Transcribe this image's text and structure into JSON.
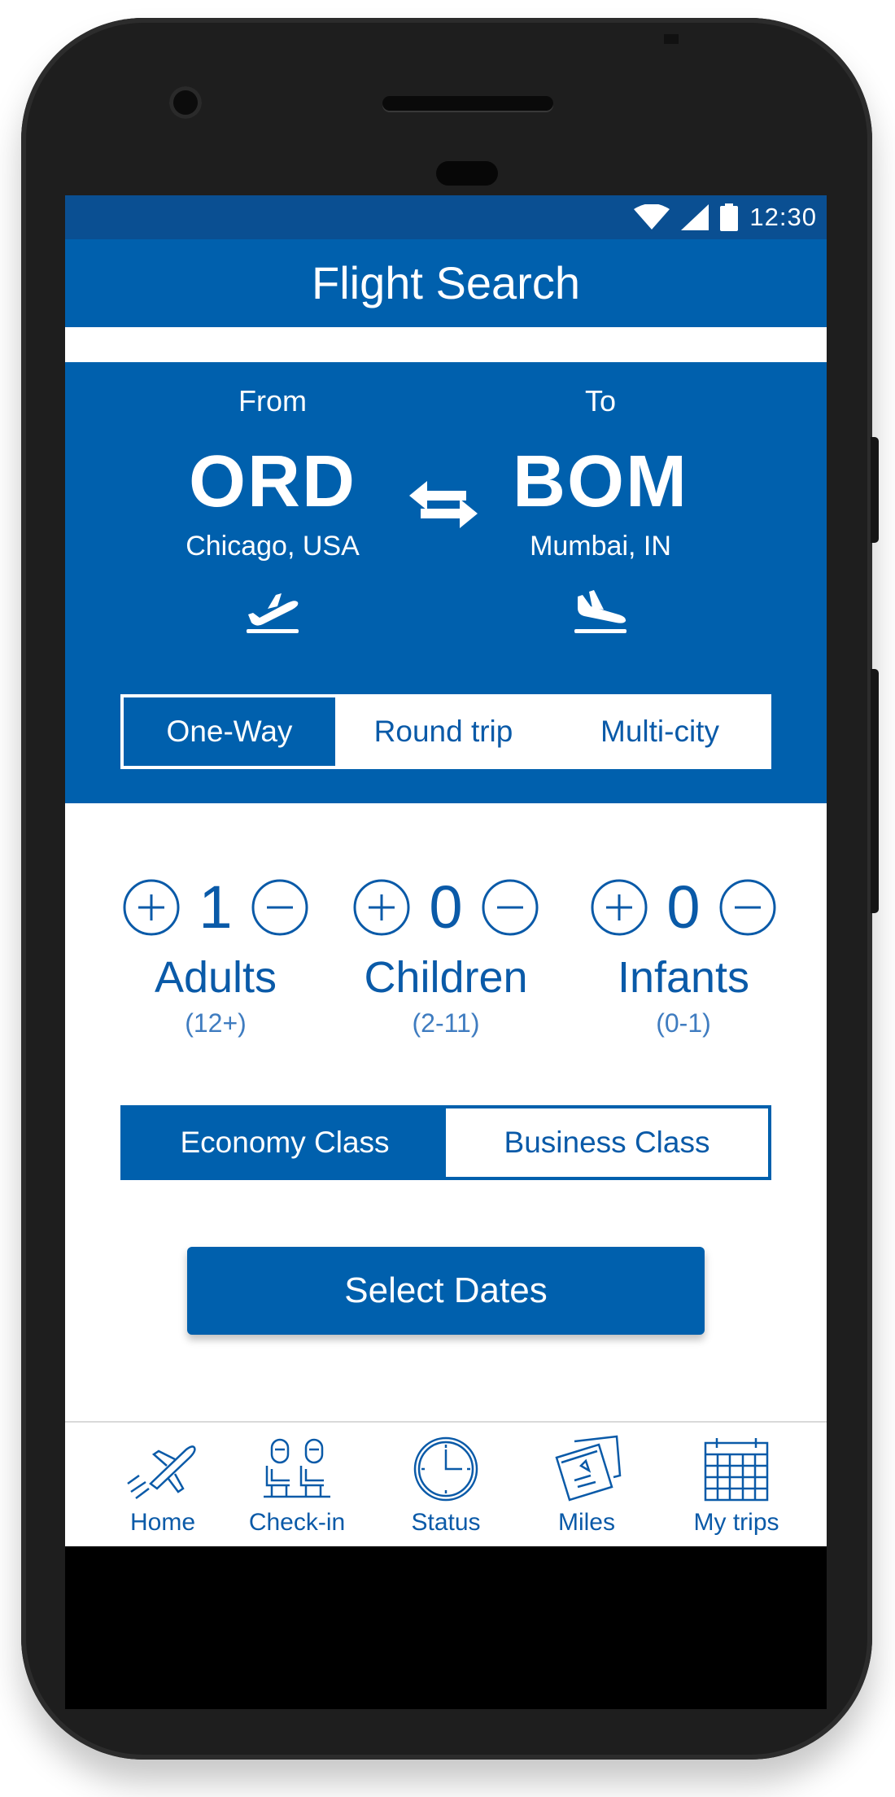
{
  "status_bar": {
    "time": "12:30",
    "icons": [
      "wifi-icon",
      "signal-icon",
      "battery-icon"
    ]
  },
  "app_bar": {
    "title": "Flight Search"
  },
  "route": {
    "from": {
      "label": "From",
      "code": "ORD",
      "city": "Chicago, USA",
      "icon": "takeoff-icon"
    },
    "to": {
      "label": "To",
      "code": "BOM",
      "city": "Mumbai, IN",
      "icon": "landing-icon"
    },
    "swap_icon": "swap-arrows-icon"
  },
  "trip_type": {
    "options": [
      "One-Way",
      "Round trip",
      "Multi-city"
    ],
    "selected": "One-Way"
  },
  "passengers": [
    {
      "name": "Adults",
      "range": "(12+)",
      "count": "1"
    },
    {
      "name": "Children",
      "range": "(2-11)",
      "count": "0"
    },
    {
      "name": "Infants",
      "range": "(0-1)",
      "count": "0"
    }
  ],
  "cabin_class": {
    "options": [
      "Economy Class",
      "Business Class"
    ],
    "selected": "Economy Class"
  },
  "cta": {
    "label": "Select Dates"
  },
  "bottom_nav": [
    {
      "label": "Home",
      "icon": "plane-icon"
    },
    {
      "label": "Check-in",
      "icon": "seats-icon"
    },
    {
      "label": "Status",
      "icon": "clock-icon"
    },
    {
      "label": "Miles",
      "icon": "tickets-icon"
    },
    {
      "label": "My trips",
      "icon": "calendar-icon"
    }
  ],
  "colors": {
    "primary": "#0060ad",
    "status_bar": "#0a4f92",
    "text_blue": "#0a5aa8"
  }
}
